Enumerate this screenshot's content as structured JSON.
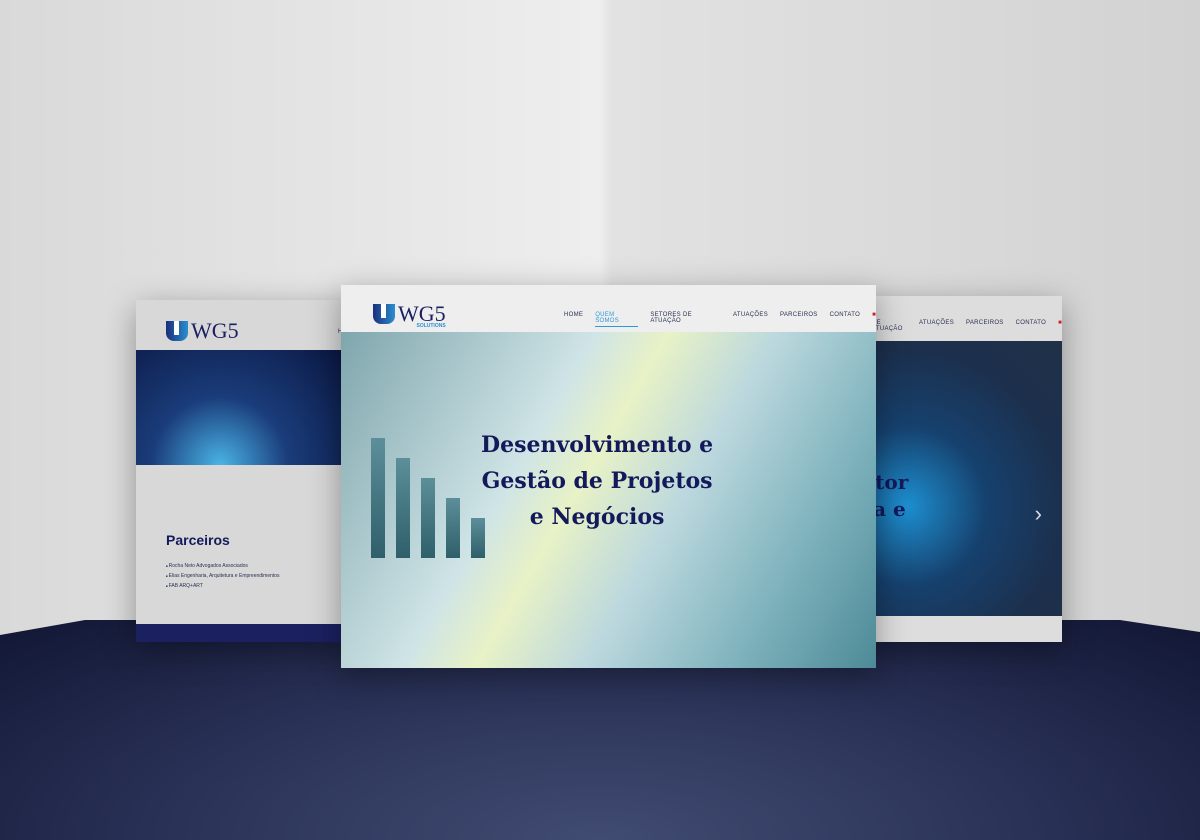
{
  "brand": {
    "name": "WG5",
    "tagline": "SOLUTIONS"
  },
  "nav": {
    "items": [
      "HOME",
      "QUEM SOMOS",
      "SETORES DE ATUAÇÃO",
      "ATUAÇÕES",
      "PARCEIROS",
      "CONTATO"
    ],
    "active": "QUEM SOMOS",
    "language_flag": "uk-flag-icon"
  },
  "left_page": {
    "nav_partial": "H",
    "title": "Parceiros",
    "partners": [
      "Rocha Neto Advogados Associados",
      "Elias Engenharia, Arquitetura e Empreendimentos",
      "FAB ARQ+ART"
    ]
  },
  "center_page": {
    "hero_lines": [
      "Desenvolvimento e",
      "Gestão de Projetos",
      "e Negócios"
    ]
  },
  "right_page": {
    "nav_items": [
      "DE ATUAÇÃO",
      "ATUAÇÕES",
      "PARCEIROS",
      "CONTATO"
    ],
    "hero_lines": [
      "Setor",
      "ura e"
    ]
  },
  "colors": {
    "navy": "#13195a",
    "accent": "#2a9ad8",
    "floor": "#2a3257"
  }
}
